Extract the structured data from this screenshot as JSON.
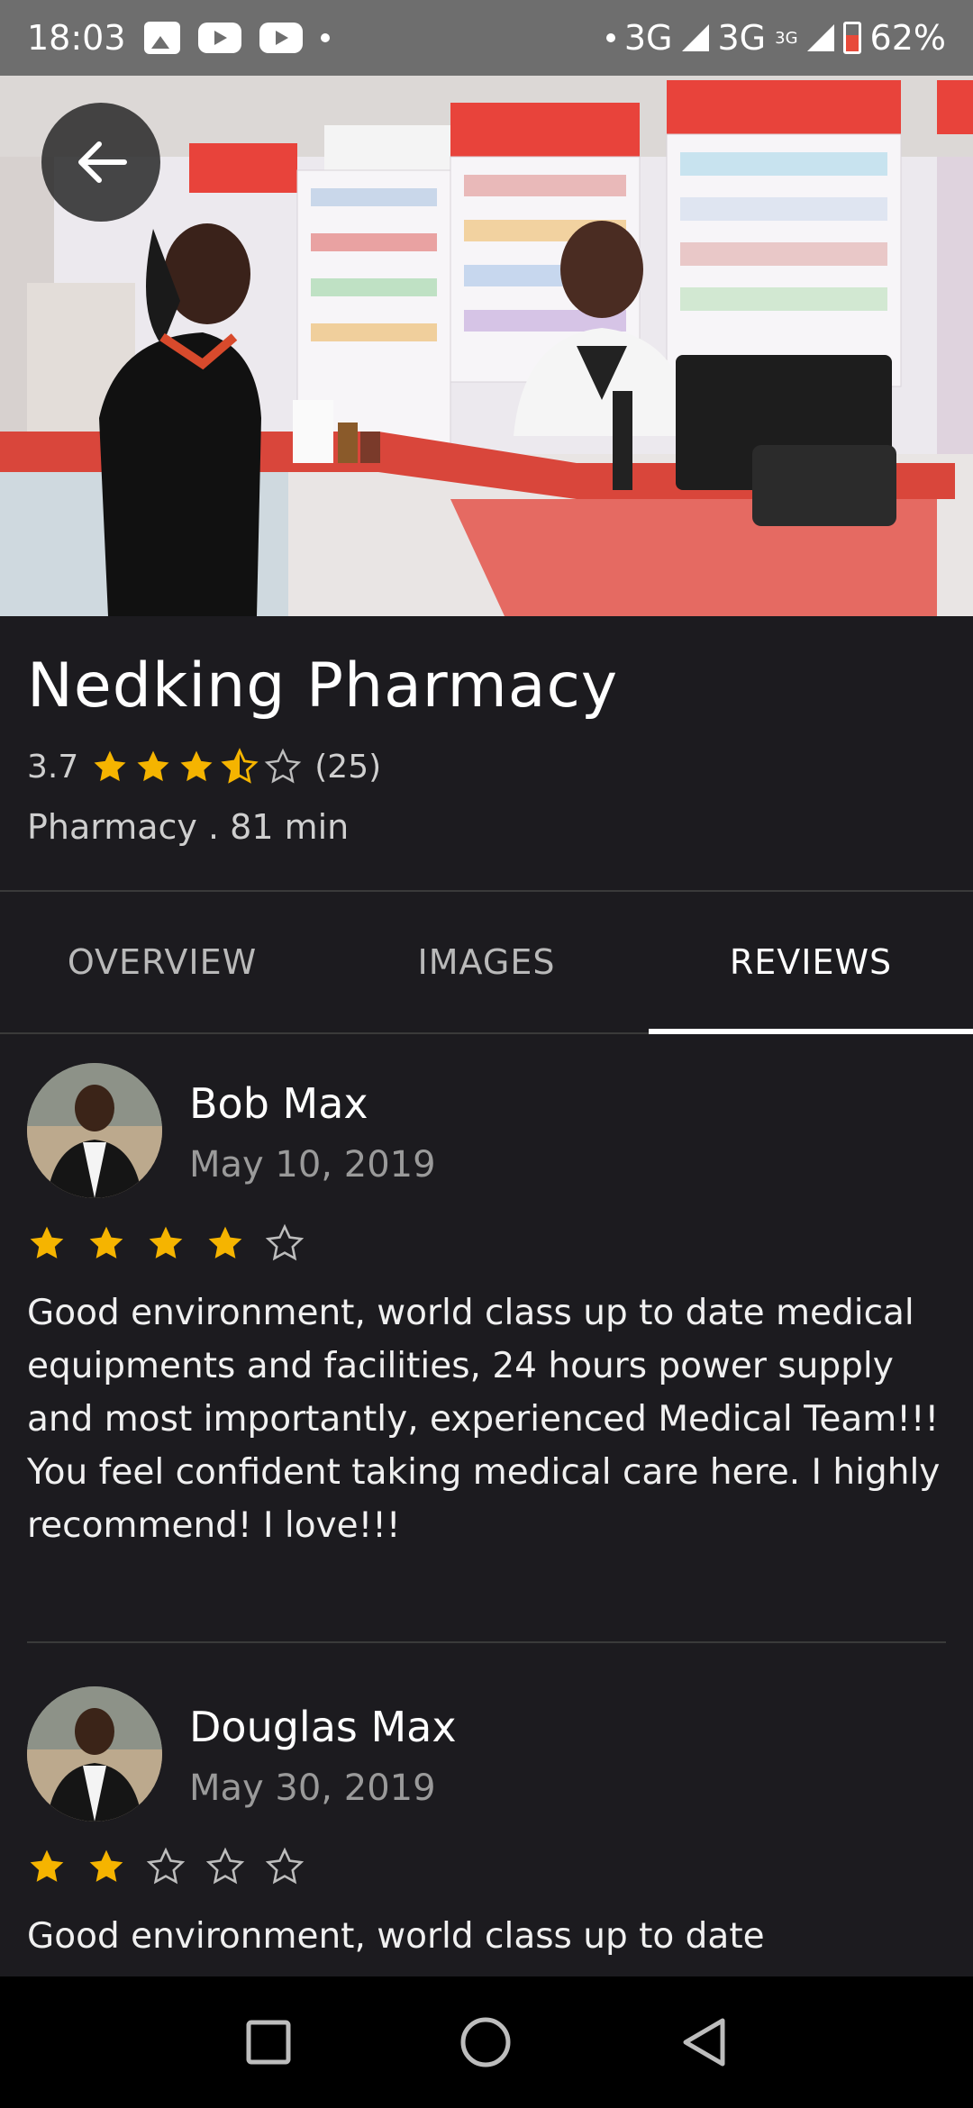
{
  "status_bar": {
    "time": "18:03",
    "network1": "3G",
    "network2": "3G",
    "network2_sup": "3G",
    "battery": "62%"
  },
  "place": {
    "name": "Nedking Pharmacy",
    "rating": "3.7",
    "rating_value": 3.5,
    "review_count": "(25)",
    "category_line": "Pharmacy . 81 min"
  },
  "tabs": [
    {
      "label": "OVERVIEW"
    },
    {
      "label": "IMAGES"
    },
    {
      "label": "REVIEWS"
    }
  ],
  "reviews": [
    {
      "name": "Bob Max",
      "date": "May 10, 2019",
      "stars": 4,
      "text": "Good environment, world class up to date medical equipments and facilities, 24 hours power supply and most importantly, experienced Medical Team!!! You feel confident taking medical care here. I highly recommend! I love!!!"
    },
    {
      "name": "Douglas Max",
      "date": "May 30, 2019",
      "stars": 2,
      "text": "Good environment, world class up to date"
    }
  ],
  "colors": {
    "star": "#f5b400",
    "background": "#1c1b1f",
    "status_bar": "#6e6e6e"
  }
}
